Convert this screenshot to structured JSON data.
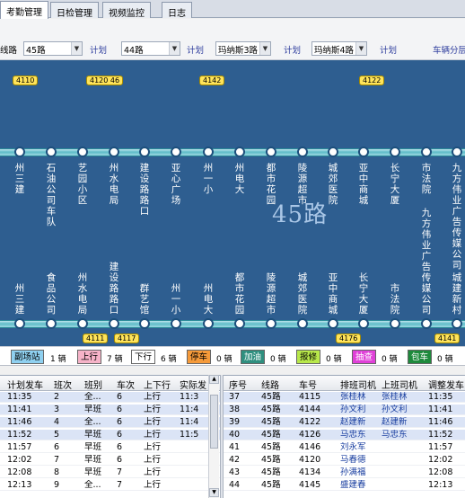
{
  "tabs": [
    "考勤管理",
    "日检管理",
    "视频监控",
    "日志"
  ],
  "filters": {
    "label_route_prefix": "线路",
    "combos": [
      {
        "label": "45路",
        "plan_label": "计划"
      },
      {
        "label": "44路",
        "plan_label": "计划"
      },
      {
        "label": "玛纳斯3路",
        "plan_label": "计划"
      },
      {
        "label": "玛纳斯4路",
        "plan_label": "计划"
      }
    ],
    "vehicle_group_label": "车辆分层"
  },
  "route": {
    "title": "45路",
    "upper_stops": [
      "州三建",
      "石油公司车队",
      "艺园小区",
      "州水电局",
      "建设路路口",
      "亚心广场",
      "州一小",
      "州电大",
      "都市花园",
      "陵源超市",
      "城郊医院",
      "亚中商城",
      "长宁大厦",
      "市法院",
      "九方伟业广告传媒公司"
    ],
    "lower_stops": [
      "州三建",
      "食品公司",
      "州水电局",
      "建设路路口",
      "群艺馆",
      "州一小",
      "州电大",
      "都市花园",
      "陵源超市",
      "城郊医院",
      "亚中商城",
      "长宁大厦",
      "市法院",
      "九方伟业广告传媒公司",
      "城建新村"
    ],
    "upper_buses": [
      "4110",
      "4120 46",
      "4142",
      "4122"
    ],
    "lower_buses": [
      "4111",
      "4117",
      "4176",
      "4141"
    ]
  },
  "legend": [
    {
      "label": "副场站",
      "count": "1 辆",
      "bg": "#8fd0f0"
    },
    {
      "label": "上行",
      "count": "7 辆",
      "bg": "#f6b3c8"
    },
    {
      "label": "下行",
      "count": "6 辆",
      "bg": "#ffffff"
    },
    {
      "label": "停车",
      "count": "0 辆",
      "bg": "#f59a3a"
    },
    {
      "label": "加油",
      "count": "0 辆",
      "bg": "#2f8f7f"
    },
    {
      "label": "报修",
      "count": "0 辆",
      "bg": "#b8e84a"
    },
    {
      "label": "抽查",
      "count": "0 辆",
      "bg": "#e040d8"
    },
    {
      "label": "包车",
      "count": "0 辆",
      "bg": "#1e8a3c"
    }
  ],
  "left_table": {
    "headers": [
      "计划发车",
      "班次",
      "班别",
      "车次",
      "上下行",
      "实际发"
    ],
    "rows": [
      [
        "11:35",
        "2",
        "全...",
        "6",
        "上行",
        "11:3"
      ],
      [
        "11:41",
        "3",
        "早班",
        "6",
        "上行",
        "11:4"
      ],
      [
        "11:46",
        "4",
        "全...",
        "6",
        "上行",
        "11:4"
      ],
      [
        "11:52",
        "5",
        "早班",
        "6",
        "上行",
        "11:5"
      ],
      [
        "11:57",
        "6",
        "早班",
        "6",
        "上行",
        ""
      ],
      [
        "12:02",
        "7",
        "早班",
        "6",
        "上行",
        ""
      ],
      [
        "12:08",
        "8",
        "早班",
        "7",
        "上行",
        ""
      ],
      [
        "12:13",
        "9",
        "全...",
        "7",
        "上行",
        ""
      ]
    ]
  },
  "right_table": {
    "headers": [
      "序号",
      "线路",
      "车号",
      "排班司机",
      "上班司机",
      "调整发车"
    ],
    "rows": [
      [
        "37",
        "45路",
        "4115",
        "张桂林",
        "张桂林",
        "11:35"
      ],
      [
        "38",
        "45路",
        "4144",
        "孙文利",
        "孙文利",
        "11:41"
      ],
      [
        "39",
        "45路",
        "4122",
        "赵建新",
        "赵建新",
        "11:46"
      ],
      [
        "40",
        "45路",
        "4126",
        "马忠东",
        "马忠东",
        "11:52"
      ],
      [
        "41",
        "45路",
        "4146",
        "刘永军",
        "",
        "11:57"
      ],
      [
        "42",
        "45路",
        "4120",
        "马春德",
        "",
        "12:02"
      ],
      [
        "43",
        "45路",
        "4134",
        "孙满福",
        "",
        "12:08"
      ],
      [
        "44",
        "45路",
        "4145",
        "盛建春",
        "",
        "12:13"
      ]
    ]
  }
}
